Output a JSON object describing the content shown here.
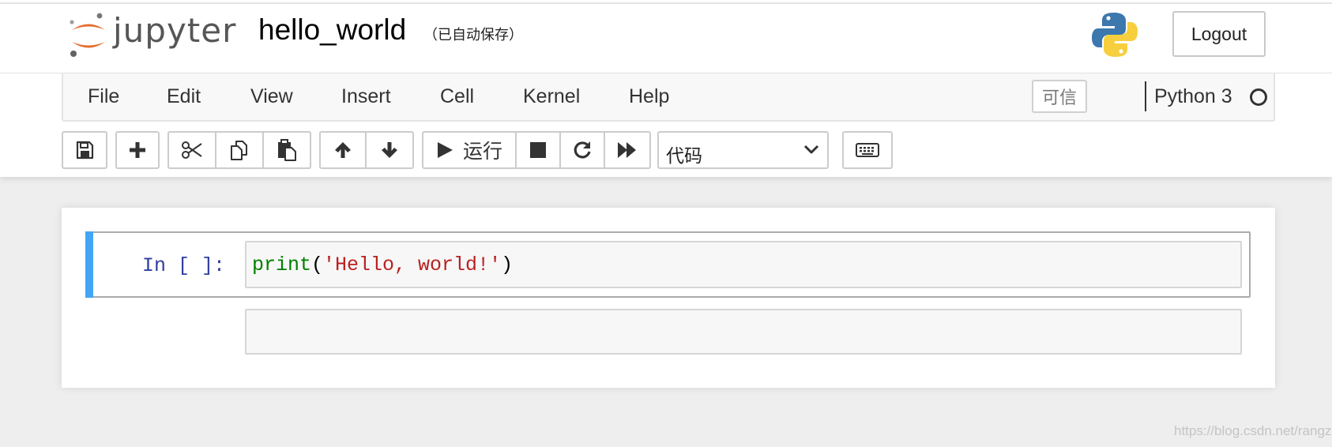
{
  "app": {
    "logo_text": "jupyter",
    "notebook_name": "hello_world",
    "autosave_status": "（已自动保存）",
    "logout_label": "Logout"
  },
  "menubar": {
    "items": [
      {
        "label": "File"
      },
      {
        "label": "Edit"
      },
      {
        "label": "View"
      },
      {
        "label": "Insert"
      },
      {
        "label": "Cell"
      },
      {
        "label": "Kernel"
      },
      {
        "label": "Help"
      }
    ],
    "trusted_label": "可信",
    "kernel_name": "Python 3",
    "kernel_status": "idle"
  },
  "toolbar": {
    "buttons": [
      {
        "icon": "save-icon"
      },
      {
        "icon": "plus-icon"
      },
      {
        "icon": "cut-icon"
      },
      {
        "icon": "copy-icon"
      },
      {
        "icon": "paste-icon"
      },
      {
        "icon": "arrow-up-icon"
      },
      {
        "icon": "arrow-down-icon"
      },
      {
        "icon": "play-icon",
        "label": "运行"
      },
      {
        "icon": "stop-icon"
      },
      {
        "icon": "restart-icon"
      },
      {
        "icon": "fast-forward-icon"
      },
      {
        "icon": "keyboard-icon"
      }
    ],
    "run_label": "运行",
    "cell_type_selected": "代码"
  },
  "notebook": {
    "cells": [
      {
        "prompt": "In [ ]:",
        "code_tokens": {
          "builtin": "print",
          "open_paren": "(",
          "string": "'Hello, world!'",
          "close_paren": ")"
        }
      },
      {
        "prompt": "",
        "code": ""
      }
    ]
  },
  "watermark": "https://blog.csdn.net/rangzh",
  "colors": {
    "selection_bar": "#42a5f5",
    "prompt": "#303f9f",
    "builtin": "#008000",
    "string": "#ba2121",
    "logo_orange": "#e46e2e"
  }
}
